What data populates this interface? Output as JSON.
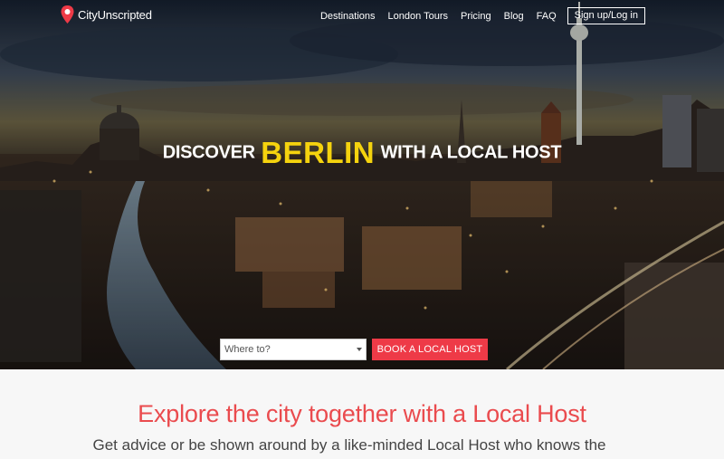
{
  "brand": {
    "name": "CityUnscripted",
    "accent": "#ee3a47"
  },
  "nav": {
    "links": [
      "Destinations",
      "London Tours",
      "Pricing",
      "Blog",
      "FAQ"
    ],
    "signup_label": "Sign up/Log in"
  },
  "hero": {
    "headline_pre": "DISCOVER",
    "headline_city": "BERLIN",
    "headline_post": "WITH A LOCAL HOST",
    "city_color": "#f5d30e"
  },
  "search": {
    "placeholder": "Where to?",
    "button_label": "BOOK A LOCAL HOST"
  },
  "content": {
    "heading": "Explore the city together with a Local Host",
    "subheading": "Get advice or be shown around by a like-minded Local Host who knows the",
    "heading_color": "#ea4b4e"
  }
}
